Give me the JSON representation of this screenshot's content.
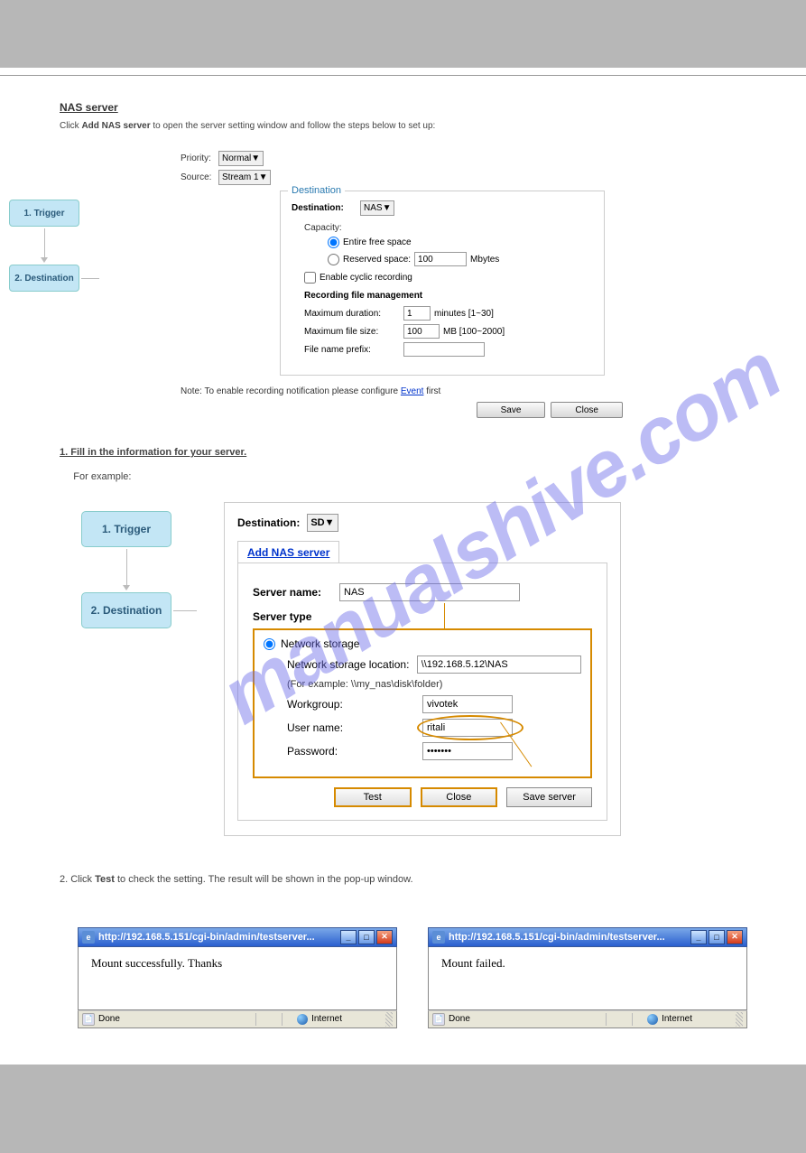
{
  "watermark": "manualshive.com",
  "heading1": "NAS server",
  "para1_a": "Click ",
  "para1_b": "Add NAS server",
  "para1_c": " to open the server setting window and follow the steps below to set up:",
  "sec1": {
    "priority_lbl": "Priority:",
    "priority_val": "Normal",
    "source_lbl": "Source:",
    "source_val": "Stream 1",
    "step1": "1. Trigger",
    "step2": "2. Destination",
    "legend": "Destination",
    "dest_lbl": "Destination:",
    "dest_val": "NAS",
    "capacity_lbl": "Capacity:",
    "opt_entire": "Entire free space",
    "opt_reserved": "Reserved space:",
    "reserved_val": "100",
    "reserved_unit": "Mbytes",
    "cyclic_lbl": "Enable cyclic recording",
    "mgmt_title": "Recording file management",
    "maxdur_lbl": "Maximum duration:",
    "maxdur_val": "1",
    "maxdur_unit": "minutes [1~30]",
    "maxsize_lbl": "Maximum file size:",
    "maxsize_val": "100",
    "maxsize_unit": "MB [100~2000]",
    "prefix_lbl": "File name prefix:",
    "prefix_val": "",
    "note_a": "Note: To enable recording notification please configure ",
    "note_link": "Event",
    "note_b": " first",
    "save_btn": "Save",
    "close_btn": "Close"
  },
  "text_mid_a": "1. Fill in the information for your server.",
  "text_mid_b": "     For example:",
  "sec2": {
    "step1": "1. Trigger",
    "step2": "2. Destination",
    "dest_lbl": "Destination:",
    "dest_val": "SD",
    "addnas": "Add NAS server",
    "srvname_lbl": "Server name:",
    "srvname_val": "NAS",
    "srvtype": "Server type",
    "ns_radio": "Network storage",
    "loc_lbl": "Network storage location:",
    "loc_val": "\\\\192.168.5.12\\NAS",
    "example": "(For example: \\\\my_nas\\disk\\folder)",
    "wg_lbl": "Workgroup:",
    "wg_val": "vivotek",
    "user_lbl": "User name:",
    "user_val": "ritali",
    "pw_lbl": "Password:",
    "pw_val": "•••••••",
    "test_btn": "Test",
    "close_btn": "Close",
    "saveserver_btn": "Save server"
  },
  "caption_a": "2. Click ",
  "caption_b": "Test",
  "caption_c": " to check the setting. The result will be shown in the pop-up window.",
  "dlg1": {
    "title": "http://192.168.5.151/cgi-bin/admin/testserver... ",
    "body": "Mount successfully. Thanks",
    "done": "Done",
    "internet": "Internet"
  },
  "dlg2": {
    "title": "http://192.168.5.151/cgi-bin/admin/testserver... ",
    "body": "Mount failed.",
    "done": "Done",
    "internet": "Internet"
  }
}
